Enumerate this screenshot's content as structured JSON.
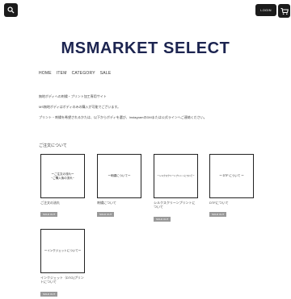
{
  "header": {
    "search_icon": "search-icon",
    "login_label": "LOGIN",
    "cart_icon": "cart-icon"
  },
  "logo": "MSMARKET SELECT",
  "nav": [
    "HOME",
    "ITEM",
    "CATEGORY",
    "SALE"
  ],
  "intro": [
    "無地ボディへの刺繍・プリント加工専用サイト",
    "MS無地ボディはボディのみの購入が可能でございます。",
    "プリント・刺繍を希望されるかたは、以下からボディを選び、InstagramのDMまたは公式ラインへご連絡ください。"
  ],
  "section_title": "ご注文について",
  "products": [
    {
      "thumb": "ーご注文の流れー\n~ご購入後の流れ~",
      "title": "ご注文の流れ",
      "badge": "SOLD OUT"
    },
    {
      "thumb": "ー刺繍についてー",
      "title": "刺繍について",
      "badge": "SOLD OUT"
    },
    {
      "thumb": "ーシルクスクリーンプリントについてー",
      "title": "シルクスクリーンプリントについて",
      "badge": "SOLD OUT"
    },
    {
      "thumb": "ー DTF について ー",
      "title": "DTFについて",
      "badge": "SOLD OUT"
    },
    {
      "thumb": "ーインクジェットについてー",
      "title": "インクジェット（DTG)プリントについて",
      "badge": "SOLD OUT"
    }
  ]
}
